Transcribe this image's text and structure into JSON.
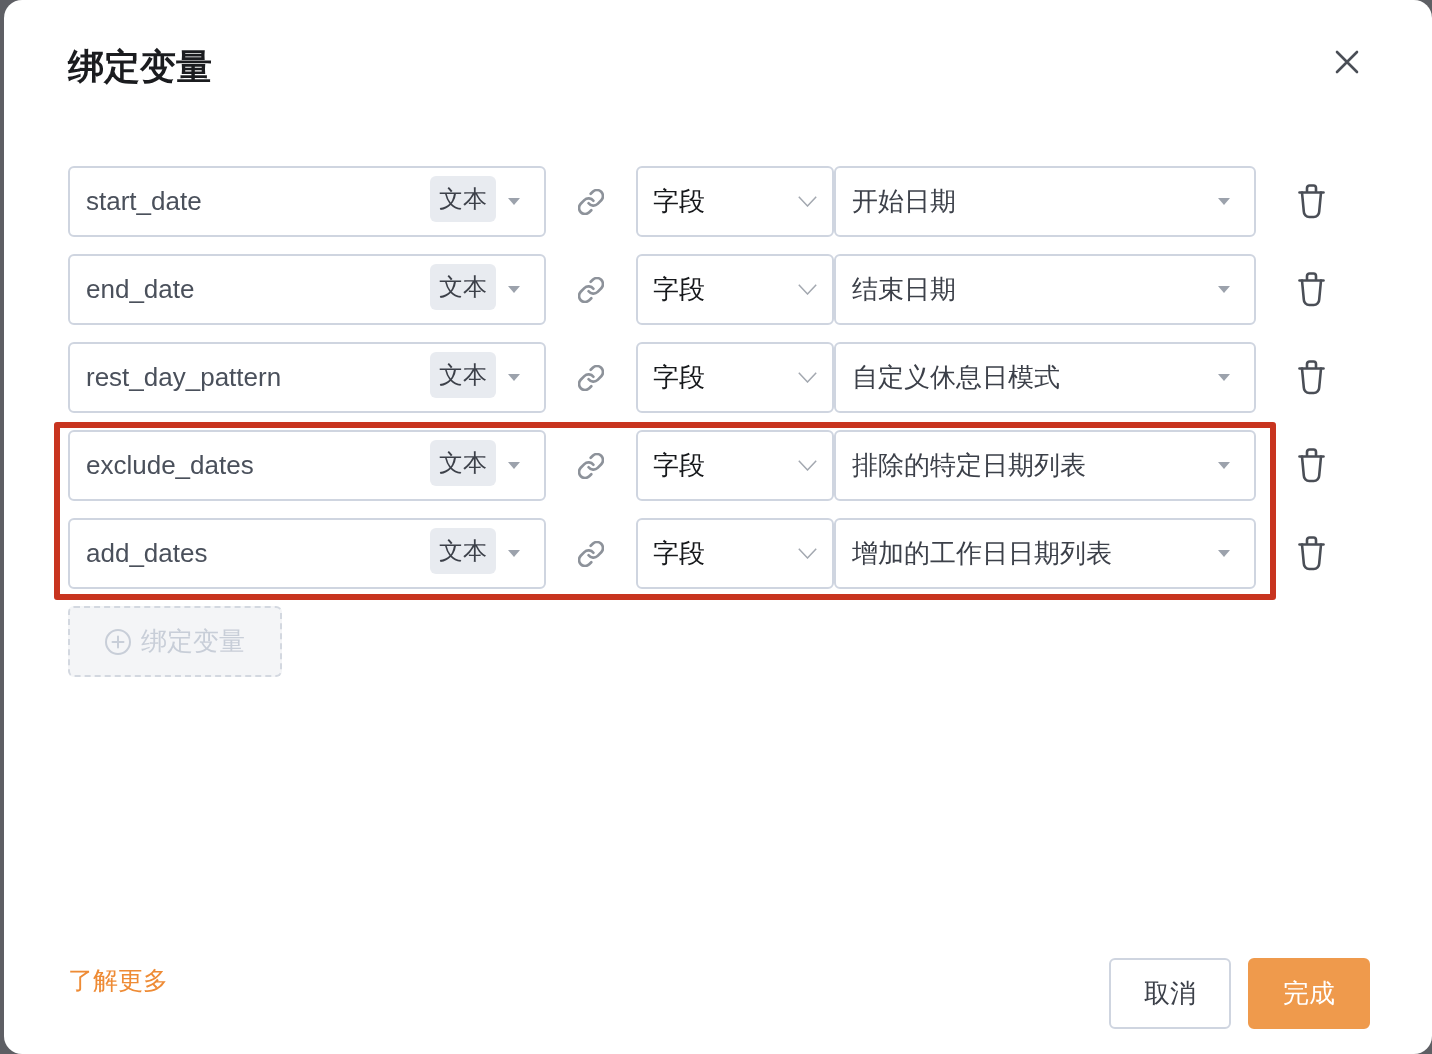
{
  "dialog": {
    "title": "绑定变量"
  },
  "bindings": [
    {
      "variable": "start_date",
      "type_badge": "文本",
      "source": "字段",
      "value": "开始日期",
      "highlighted": false
    },
    {
      "variable": "end_date",
      "type_badge": "文本",
      "source": "字段",
      "value": "结束日期",
      "highlighted": false
    },
    {
      "variable": "rest_day_pattern",
      "type_badge": "文本",
      "source": "字段",
      "value": "自定义休息日模式",
      "highlighted": false
    },
    {
      "variable": "exclude_dates",
      "type_badge": "文本",
      "source": "字段",
      "value": "排除的特定日期列表",
      "highlighted": true
    },
    {
      "variable": "add_dates",
      "type_badge": "文本",
      "source": "字段",
      "value": "增加的工作日日期列表",
      "highlighted": true
    }
  ],
  "add_button": {
    "label": "绑定变量",
    "disabled": true
  },
  "footer": {
    "link": "了解更多",
    "buttons": [
      {
        "label": "取消",
        "kind": "secondary"
      },
      {
        "label": "完成",
        "kind": "primary"
      }
    ]
  }
}
